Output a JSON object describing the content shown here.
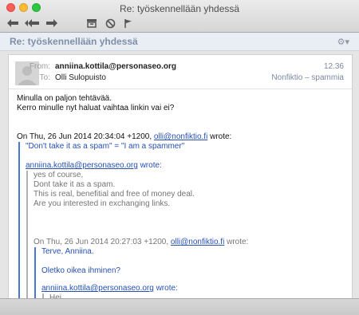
{
  "window": {
    "title": "Re: työskennellään yhdessä"
  },
  "toolbar": {
    "reply_icon": "reply-icon",
    "reply_all_icon": "reply-all-icon",
    "forward_icon": "forward-icon",
    "archive_icon": "archive-icon",
    "junk_icon": "junk-icon",
    "flag_icon": "flag-icon"
  },
  "message": {
    "subject": "Re: työskennellään yhdessä",
    "gear_icon": "⚙▾",
    "header": {
      "from_label": "From:",
      "from": "anniina.kottila@personaseo.org",
      "to_label": "To:",
      "to": "Olli Sulopuisto",
      "time": "12.36",
      "folder": "Nonfiktio – spammia"
    },
    "body": {
      "line1": "Minulla on paljon tehtävää.",
      "line2": "Kerro minulle nyt haluat vaihtaa linkin vai ei?",
      "quote1_prefix": "On Thu, 26 Jun 2014 20:34:04 +1200,",
      "quote1_email": "olli@nonfiktio.fi",
      "quote1_suffix": "wrote:",
      "q1_line": "\"Don't take it as a spam\" = \"I am a spammer\"",
      "q1_email": "anniina.kottila@personaseo.org",
      "q1_wrote": "wrote:",
      "q2_line1": "yes of course,",
      "q2_line2": "Dont take it as a spam.",
      "q2_line3": "This is real, benefitial and free of money deal.",
      "q2_line4": "Are you interested in exchanging links.",
      "quote3_prefix": "On Thu, 26 Jun 2014 20:27:03 +1200,",
      "quote3_email": "olli@nonfiktio.fi",
      "quote3_suffix": "wrote:",
      "q3_line1": "Terve, Anniina.",
      "q3_line2": "Oletko oikea ihminen?",
      "q3_email": "anniina.kottila@personaseo.org",
      "q3_wrote": "wrote:",
      "q4_line1": "Hei,"
    }
  }
}
